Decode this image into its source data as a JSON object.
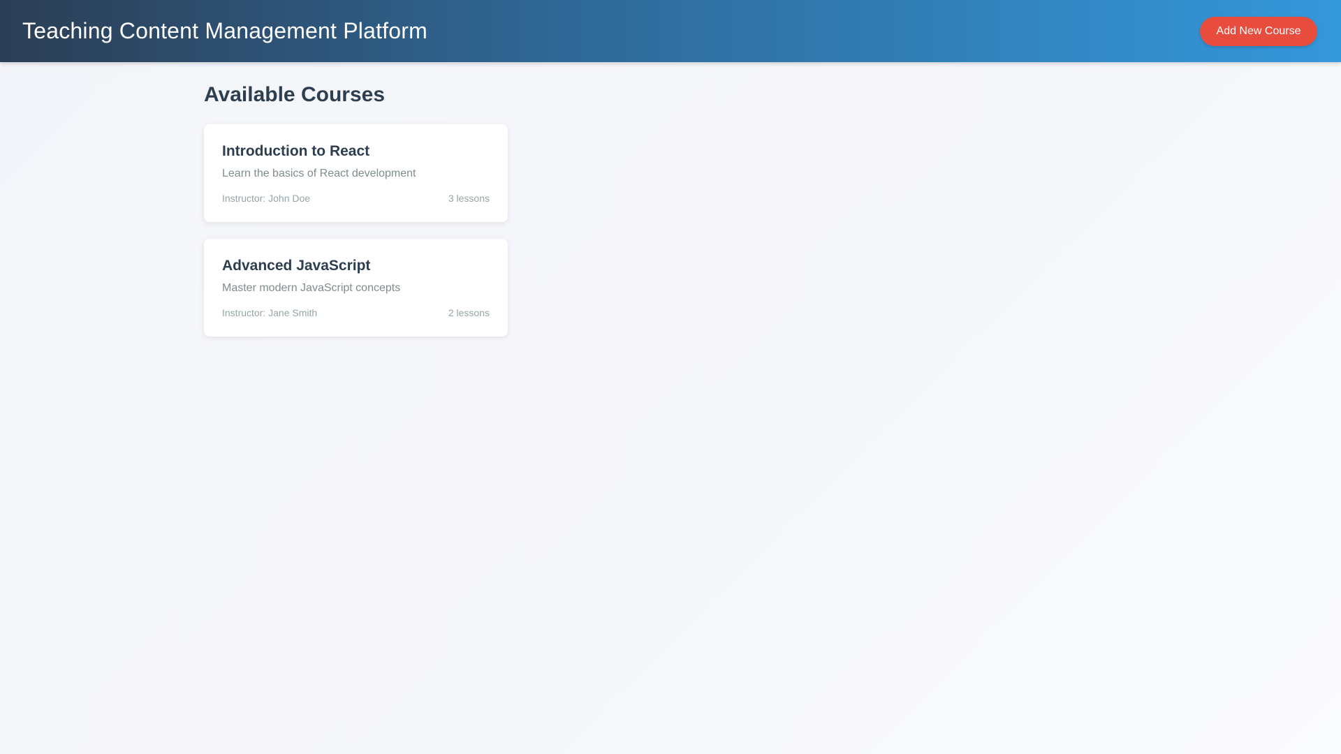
{
  "header": {
    "title": "Teaching Content Management Platform",
    "add_button_label": "Add New Course"
  },
  "main": {
    "section_title": "Available Courses",
    "courses": [
      {
        "title": "Introduction to React",
        "description": "Learn the basics of React development",
        "instructor": "Instructor: John Doe",
        "lessons": "3 lessons"
      },
      {
        "title": "Advanced JavaScript",
        "description": "Master modern JavaScript concepts",
        "instructor": "Instructor: Jane Smith",
        "lessons": "2 lessons"
      }
    ]
  },
  "colors": {
    "header_start": "#2c3e55",
    "header_end": "#3498db",
    "accent_button": "#e74c3c",
    "text_primary": "#2c3e50",
    "text_secondary": "#7f8c8d",
    "background": "#f5f6fa"
  }
}
